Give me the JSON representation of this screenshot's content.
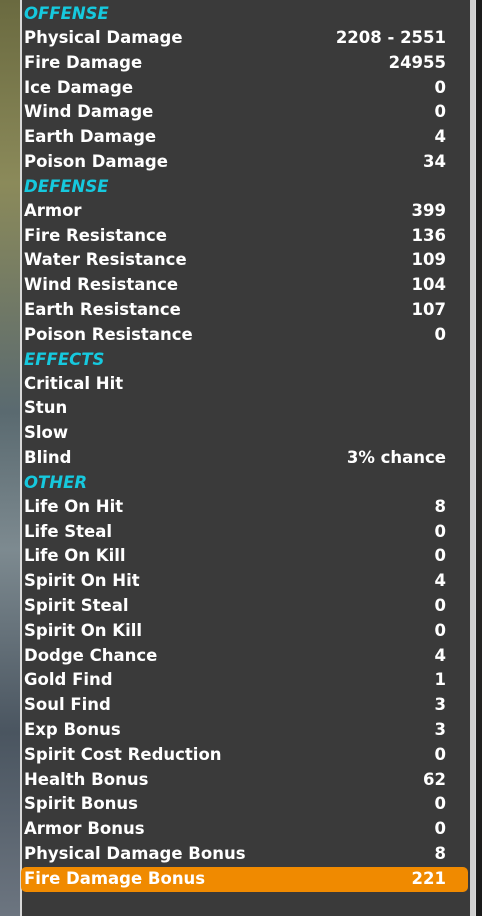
{
  "sections": [
    {
      "title": "OFFENSE",
      "rows": [
        {
          "label": "Physical Damage",
          "value": "2208 - 2551"
        },
        {
          "label": "Fire Damage",
          "value": "24955"
        },
        {
          "label": "Ice Damage",
          "value": "0"
        },
        {
          "label": "Wind Damage",
          "value": "0"
        },
        {
          "label": "Earth Damage",
          "value": "4"
        },
        {
          "label": "Poison Damage",
          "value": "34"
        }
      ]
    },
    {
      "title": "DEFENSE",
      "rows": [
        {
          "label": "Armor",
          "value": "399"
        },
        {
          "label": "Fire Resistance",
          "value": "136"
        },
        {
          "label": "Water Resistance",
          "value": "109"
        },
        {
          "label": "Wind Resistance",
          "value": "104"
        },
        {
          "label": "Earth Resistance",
          "value": "107"
        },
        {
          "label": "Poison Resistance",
          "value": "0"
        }
      ]
    },
    {
      "title": "EFFECTS",
      "rows": [
        {
          "label": "Critical Hit",
          "value": ""
        },
        {
          "label": "Stun",
          "value": ""
        },
        {
          "label": "Slow",
          "value": ""
        },
        {
          "label": "Blind",
          "value": "3% chance"
        }
      ]
    },
    {
      "title": "OTHER",
      "rows": [
        {
          "label": "Life On Hit",
          "value": "8"
        },
        {
          "label": "Life Steal",
          "value": "0"
        },
        {
          "label": "Life On Kill",
          "value": "0"
        },
        {
          "label": "Spirit On Hit",
          "value": "4"
        },
        {
          "label": "Spirit Steal",
          "value": "0"
        },
        {
          "label": "Spirit On Kill",
          "value": "0"
        },
        {
          "label": "Dodge Chance",
          "value": "4"
        },
        {
          "label": "Gold Find",
          "value": "1"
        },
        {
          "label": "Soul Find",
          "value": "3"
        },
        {
          "label": "Exp Bonus",
          "value": "3"
        },
        {
          "label": "Spirit Cost Reduction",
          "value": "0"
        },
        {
          "label": "Health Bonus",
          "value": "62"
        },
        {
          "label": "Spirit Bonus",
          "value": "0"
        },
        {
          "label": "Armor Bonus",
          "value": "0"
        },
        {
          "label": "Physical Damage Bonus",
          "value": "8"
        },
        {
          "label": "Fire Damage Bonus",
          "value": "221",
          "selected": true
        }
      ]
    }
  ],
  "colors": {
    "section_header": "#16c9de",
    "row_text": "#ffffff",
    "panel_bg": "#3a3a3a",
    "selected_bg": "#f08a00"
  }
}
